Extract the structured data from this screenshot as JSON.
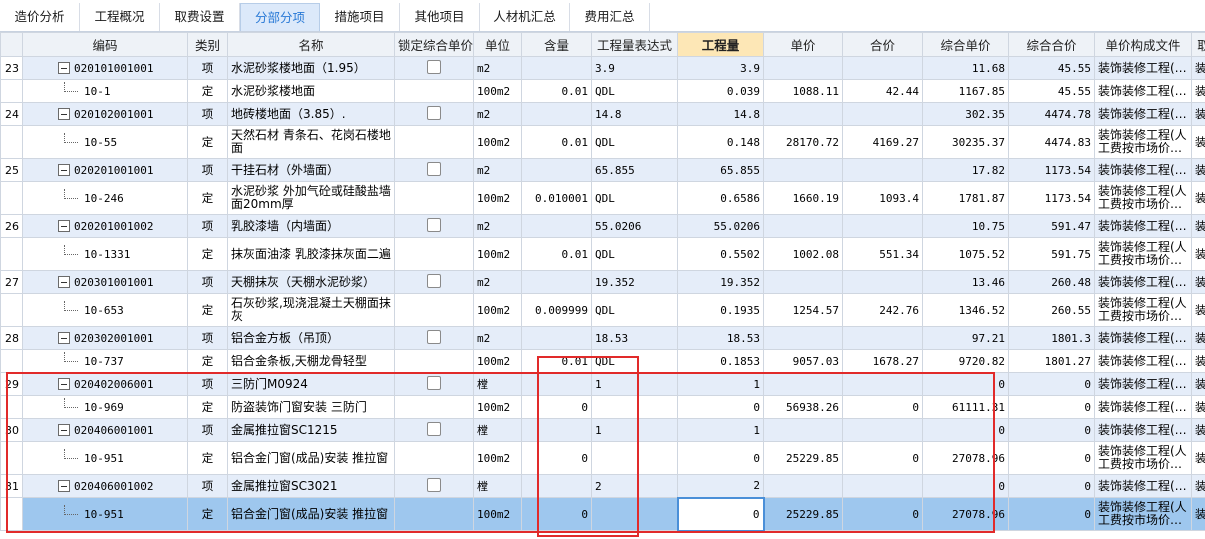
{
  "tabs": [
    {
      "label": "造价分析",
      "active": false
    },
    {
      "label": "工程概况",
      "active": false
    },
    {
      "label": "取费设置",
      "active": false
    },
    {
      "label": "分部分项",
      "active": true
    },
    {
      "label": "措施项目",
      "active": false
    },
    {
      "label": "其他项目",
      "active": false
    },
    {
      "label": "人材机汇总",
      "active": false
    },
    {
      "label": "费用汇总",
      "active": false
    }
  ],
  "columns": [
    "",
    "编码",
    "类别",
    "名称",
    "锁定综合单价",
    "单位",
    "含量",
    "工程量表达式",
    "工程量",
    "单价",
    "合价",
    "综合单价",
    "综合合价",
    "单价构成文件",
    "取费专"
  ],
  "rows": [
    {
      "type": "item",
      "no": "23",
      "code": "020101001001",
      "cat": "项",
      "name": "水泥砂浆楼地面（1.95）",
      "unit": "m2",
      "content": "",
      "expr": "3.9",
      "qty": "3.9",
      "price": "",
      "total": "",
      "uprice": "11.68",
      "utotal": "45.55",
      "file": "装饰装修工程(…",
      "fee": "装饰装修"
    },
    {
      "type": "quota",
      "no": "",
      "code": "10-1",
      "cat": "定",
      "name": "水泥砂浆楼地面",
      "unit": "100m2",
      "content": "0.01",
      "expr": "QDL",
      "qty": "0.039",
      "price": "1088.11",
      "total": "42.44",
      "uprice": "1167.85",
      "utotal": "45.55",
      "file": "装饰装修工程(…",
      "fee": "装饰装修"
    },
    {
      "type": "item",
      "no": "24",
      "code": "020102001001",
      "cat": "项",
      "name": "地砖楼地面（3.85）.",
      "unit": "m2",
      "content": "",
      "expr": "14.8",
      "qty": "14.8",
      "price": "",
      "total": "",
      "uprice": "302.35",
      "utotal": "4474.78",
      "file": "装饰装修工程(…",
      "fee": "装饰装修"
    },
    {
      "type": "quota",
      "tall": true,
      "no": "",
      "code": "10-55",
      "cat": "定",
      "name": "天然石材 青条石、花岗石楼地面",
      "unit": "100m2",
      "content": "0.01",
      "expr": "QDL",
      "qty": "0.148",
      "price": "28170.72",
      "total": "4169.27",
      "uprice": "30235.37",
      "utotal": "4474.83",
      "file": "装饰装修工程(人工费按市场价…",
      "fee": "装饰装修"
    },
    {
      "type": "item",
      "no": "25",
      "code": "020201001001",
      "cat": "项",
      "name": "干挂石材（外墙面）",
      "unit": "m2",
      "content": "",
      "expr": "65.855",
      "qty": "65.855",
      "price": "",
      "total": "",
      "uprice": "17.82",
      "utotal": "1173.54",
      "file": "装饰装修工程(…",
      "fee": "装饰装修"
    },
    {
      "type": "quota",
      "tall": true,
      "no": "",
      "code": "10-246",
      "cat": "定",
      "name": "水泥砂浆 外加气砼或硅酸盐墙面20mm厚",
      "unit": "100m2",
      "content": "0.010001",
      "expr": "QDL",
      "qty": "0.6586",
      "price": "1660.19",
      "total": "1093.4",
      "uprice": "1781.87",
      "utotal": "1173.54",
      "file": "装饰装修工程(人工费按市场价…",
      "fee": "装饰装修"
    },
    {
      "type": "item",
      "no": "26",
      "code": "020201001002",
      "cat": "项",
      "name": "乳胶漆墙（内墙面）",
      "unit": "m2",
      "content": "",
      "expr": "55.0206",
      "qty": "55.0206",
      "price": "",
      "total": "",
      "uprice": "10.75",
      "utotal": "591.47",
      "file": "装饰装修工程(…",
      "fee": "装饰装修"
    },
    {
      "type": "quota",
      "tall": true,
      "no": "",
      "code": "10-1331",
      "cat": "定",
      "name": "抹灰面油漆 乳胶漆抹灰面二遍",
      "unit": "100m2",
      "content": "0.01",
      "expr": "QDL",
      "qty": "0.5502",
      "price": "1002.08",
      "total": "551.34",
      "uprice": "1075.52",
      "utotal": "591.75",
      "file": "装饰装修工程(人工费按市场价…",
      "fee": "装饰装修"
    },
    {
      "type": "item",
      "no": "27",
      "code": "020301001001",
      "cat": "项",
      "name": "天棚抹灰（天棚水泥砂浆）",
      "unit": "m2",
      "content": "",
      "expr": "19.352",
      "qty": "19.352",
      "price": "",
      "total": "",
      "uprice": "13.46",
      "utotal": "260.48",
      "file": "装饰装修工程(…",
      "fee": "装饰装修"
    },
    {
      "type": "quota",
      "tall": true,
      "no": "",
      "code": "10-653",
      "cat": "定",
      "name": "石灰砂浆,现浇混凝土天棚面抹灰",
      "unit": "100m2",
      "content": "0.009999",
      "expr": "QDL",
      "qty": "0.1935",
      "price": "1254.57",
      "total": "242.76",
      "uprice": "1346.52",
      "utotal": "260.55",
      "file": "装饰装修工程(人工费按市场价…",
      "fee": "装饰装修"
    },
    {
      "type": "item",
      "no": "28",
      "code": "020302001001",
      "cat": "项",
      "name": "铝合金方板（吊顶）",
      "unit": "m2",
      "content": "",
      "expr": "18.53",
      "qty": "18.53",
      "price": "",
      "total": "",
      "uprice": "97.21",
      "utotal": "1801.3",
      "file": "装饰装修工程(…",
      "fee": "装饰装修"
    },
    {
      "type": "quota",
      "no": "",
      "code": "10-737",
      "cat": "定",
      "name": "铝合金条板,天棚龙骨轻型",
      "unit": "100m2",
      "content": "0.01",
      "expr": "QDL",
      "qty": "0.1853",
      "price": "9057.03",
      "total": "1678.27",
      "uprice": "9720.82",
      "utotal": "1801.27",
      "file": "装饰装修工程(…",
      "fee": "装饰装修"
    },
    {
      "type": "item",
      "no": "29",
      "code": "020402006001",
      "cat": "项",
      "name": "三防门M0924",
      "unit": "樘",
      "content": "",
      "expr": "1",
      "qty": "1",
      "price": "",
      "total": "",
      "uprice": "0",
      "utotal": "0",
      "file": "装饰装修工程(…",
      "fee": "装饰装修"
    },
    {
      "type": "quota",
      "no": "",
      "code": "10-969",
      "cat": "定",
      "name": "防盗装饰门窗安装 三防门",
      "unit": "100m2",
      "content": "0",
      "expr": "",
      "qty": "0",
      "price": "56938.26",
      "total": "0",
      "uprice": "61111.31",
      "utotal": "0",
      "file": "装饰装修工程(…",
      "fee": "装饰装修"
    },
    {
      "type": "item",
      "no": "30",
      "code": "020406001001",
      "cat": "项",
      "name": "金属推拉窗SC1215",
      "unit": "樘",
      "content": "",
      "expr": "1",
      "qty": "1",
      "price": "",
      "total": "",
      "uprice": "0",
      "utotal": "0",
      "file": "装饰装修工程(…",
      "fee": "装饰装修"
    },
    {
      "type": "quota",
      "tall": true,
      "no": "",
      "code": "10-951",
      "cat": "定",
      "name": "铝合金门窗(成品)安装 推拉窗",
      "unit": "100m2",
      "content": "0",
      "expr": "",
      "qty": "0",
      "price": "25229.85",
      "total": "0",
      "uprice": "27078.96",
      "utotal": "0",
      "file": "装饰装修工程(人工费按市场价…",
      "fee": "装饰装修"
    },
    {
      "type": "item",
      "no": "31",
      "code": "020406001002",
      "cat": "项",
      "name": "金属推拉窗SC3021",
      "unit": "樘",
      "content": "",
      "expr": "2",
      "qty": "2",
      "price": "",
      "total": "",
      "uprice": "0",
      "utotal": "0",
      "file": "装饰装修工程(…",
      "fee": "装饰装修"
    },
    {
      "type": "quota",
      "tall": true,
      "selected": true,
      "no": "",
      "code": "10-951",
      "cat": "定",
      "name": "铝合金门窗(成品)安装 推拉窗",
      "unit": "100m2",
      "content": "0",
      "expr": "",
      "qty": "0",
      "price": "25229.85",
      "total": "0",
      "uprice": "27078.96",
      "utotal": "0",
      "file": "装饰装修工程(人工费按市场价…",
      "fee": "装饰装修"
    }
  ],
  "colors": {
    "item_row_bg": "#e5edf9",
    "selected_row_bg": "#9ec7ee",
    "active_tab_text": "#2a7ad6",
    "annotation_red": "#e12a2a"
  }
}
